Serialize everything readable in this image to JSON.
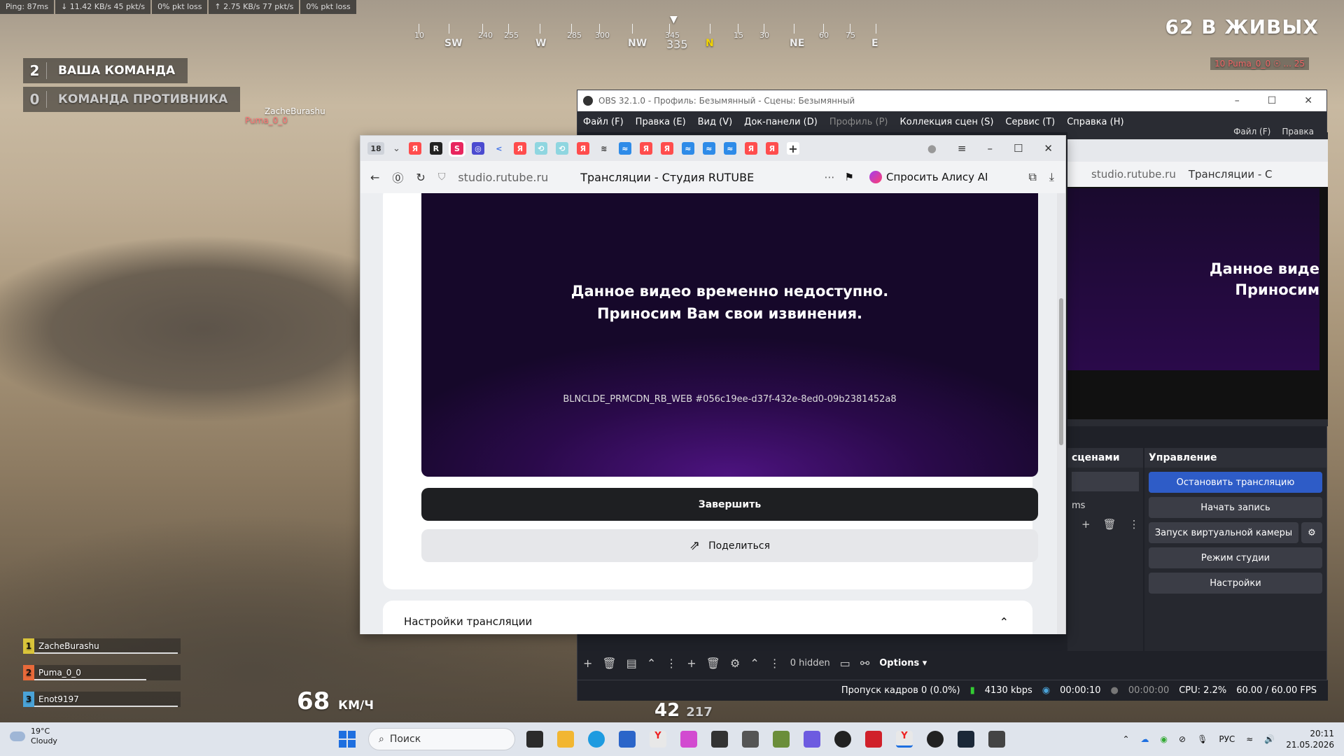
{
  "hud": {
    "ping": "Ping: 87ms",
    "down": "↓ 11.42 KB/s   45 pkt/s",
    "down_loss": "0% pkt loss",
    "up": "↑ 2.75 KB/s   77 pkt/s",
    "up_loss": "0% pkt loss",
    "compass": {
      "heading": "335",
      "marks": [
        "10",
        "SW",
        "240",
        "255",
        "W",
        "285",
        "300",
        "NW",
        "345",
        "N",
        "15",
        "30",
        "NE",
        "60",
        "75",
        "E"
      ]
    },
    "team_ours": {
      "score": "2",
      "name": "ВАША КОМАНДА"
    },
    "team_enemy": {
      "score": "0",
      "name": "КОМАНДА ПРОТИВНИКА"
    },
    "alive": "62 В ЖИВЫХ",
    "killfeed": "10 Puma_0_0 ☉ ... 25",
    "player_label_1": "ZacheBurashu",
    "player_label_2": "Puma_0_0",
    "squad": [
      {
        "idx": "1",
        "name": "ZacheBurashu",
        "color": "#d9c43a"
      },
      {
        "idx": "2",
        "name": "Puma_0_0",
        "color": "#e86a3a"
      },
      {
        "idx": "3",
        "name": "Enot9197",
        "color": "#4aa3d8"
      }
    ],
    "speed": "68",
    "speed_unit": "КМ/Ч",
    "ammo": "42",
    "ammo_total": "217"
  },
  "obs": {
    "title": "OBS 32.1.0 - Профиль: Безымянный - Сцены: Безымянный",
    "menu": [
      "Файл (F)",
      "Правка (E)",
      "Вид (V)",
      "Док-панели (D)",
      "Профиль (P)",
      "Коллекция сцен (S)",
      "Сервис (T)",
      "Справка (H)"
    ],
    "preview": {
      "menu1": "Файл (F)",
      "menu2": "Правка",
      "url": "studio.rutube.ru",
      "title": "Трансляции - С",
      "msg1": "Данное виде",
      "msg2": "Приносим"
    },
    "scenes_head": "сценами",
    "scenes_item": "ms",
    "controls": {
      "head": "Управление",
      "stop": "Остановить трансляцию",
      "record": "Начать запись",
      "vcam": "Запуск виртуальной камеры",
      "studio": "Режим студии",
      "settings": "Настройки"
    },
    "tools": {
      "hidden": "0 hidden",
      "options": "Options"
    },
    "status": {
      "dropped": "Пропуск кадров 0 (0.0%)",
      "kbps": "4130 kbps",
      "stream_time": "00:00:10",
      "rec_time": "00:00:00",
      "cpu": "CPU: 2.2%",
      "fps": "60.00 / 60.00 FPS"
    }
  },
  "browser": {
    "tab_count": "18",
    "url": "studio.rutube.ru",
    "title": "Трансляции - Студия RUTUBE",
    "alice": "Спросить Алису AI",
    "video_msg_1": "Данное видео временно недоступно.",
    "video_msg_2": "Приносим Вам свои извинения.",
    "video_code": "BLNCLDE_PRMCDN_RB_WEB #056c19ee-d37f-432e-8ed0-09b2381452a8",
    "finish_label": "Завершить",
    "share_label": "Поделиться",
    "settings_label": "Настройки трансляции"
  },
  "taskbar": {
    "temp": "19°C",
    "weather": "Cloudy",
    "search": "Поиск",
    "lang": "РУС",
    "time": "20:11",
    "date": "21.05.2026"
  }
}
